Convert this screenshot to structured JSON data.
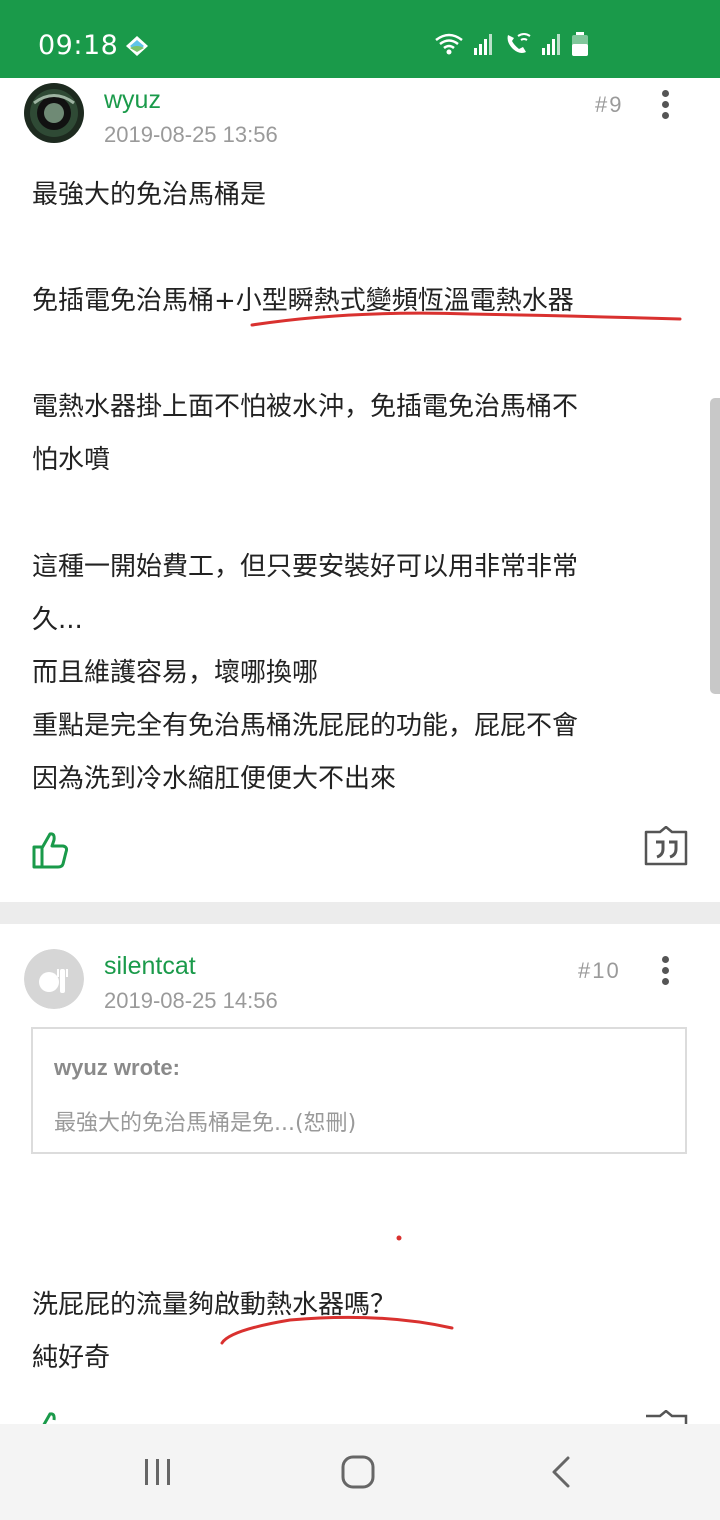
{
  "status_bar": {
    "time": "09:18",
    "icons": [
      "wifi-icon",
      "signal-icon",
      "wifi-call-icon",
      "signal-icon",
      "battery-icon"
    ]
  },
  "posts": [
    {
      "username": "wyuz",
      "timestamp": "2019-08-25 13:56",
      "floor": "#9",
      "body_lines": [
        "最強大的免治馬桶是",
        "免插電免治馬桶+小型瞬熱式變頻恆溫電熱水器",
        "電熱水器掛上面不怕被水沖，免插電免治馬桶不",
        "怕水噴",
        "這種一開始費工，但只要安裝好可以用非常非常",
        "久...",
        "而且維護容易，壞哪換哪",
        "重點是完全有免治馬桶洗屁屁的功能，屁屁不會",
        "因為洗到冷水縮肛便便大不出來"
      ]
    },
    {
      "username": "silentcat",
      "timestamp": "2019-08-25 14:56",
      "floor": "#10",
      "quote": {
        "author": "wyuz wrote:",
        "text": "最強大的免治馬桶是免...(恕刪)"
      },
      "body_lines": [
        "洗屁屁的流量夠啟動熱水器嗎？",
        "純好奇"
      ]
    }
  ],
  "colors": {
    "accent": "#1a9a4a",
    "annotation": "#d9312f",
    "divider": "#ececec"
  },
  "nav": {
    "buttons": [
      "recent-apps-icon",
      "home-icon",
      "back-icon"
    ]
  }
}
